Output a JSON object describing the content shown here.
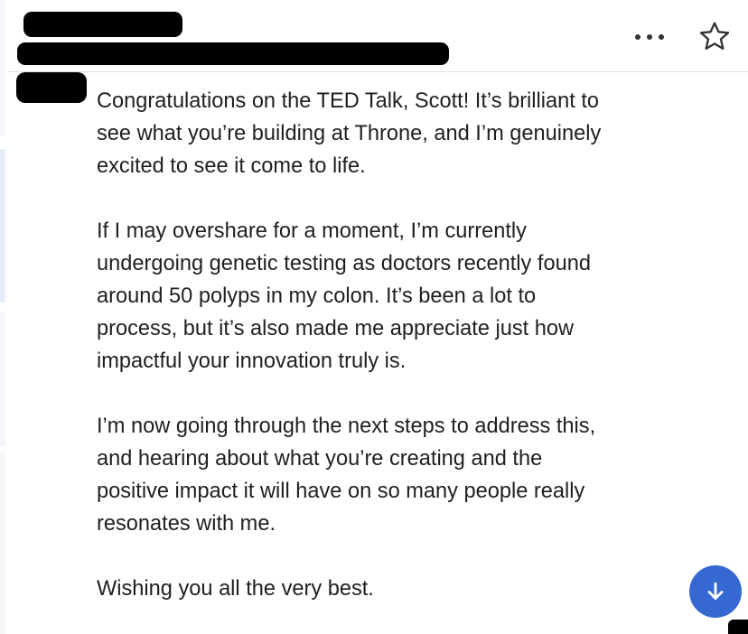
{
  "header": {
    "more_icon": "more-horizontal-icon",
    "star_icon": "star-outline-icon"
  },
  "message": {
    "paragraphs": [
      "Congratulations on the TED Talk, Scott! It’s brilliant to\nsee what you’re building at Throne, and I’m genuinely\nexcited to see it come to life.",
      "If I may overshare for a moment, I’m currently\nundergoing genetic testing as doctors recently found\naround 50 polyps in my colon. It’s been a lot to\nprocess, but it’s also made me appreciate just how\nimpactful your innovation truly is.",
      "I’m now going through the next steps to address this,\nand hearing about what you’re creating and the\npositive impact it will have on so many people really\nresonates with me.",
      "Wishing you all the very best."
    ]
  },
  "scroll_button": {
    "icon": "arrow-down-icon",
    "color": "#3569d1"
  },
  "colors": {
    "text": "#1f1f1f",
    "divider": "#e3e3e3",
    "redaction": "#000000"
  }
}
